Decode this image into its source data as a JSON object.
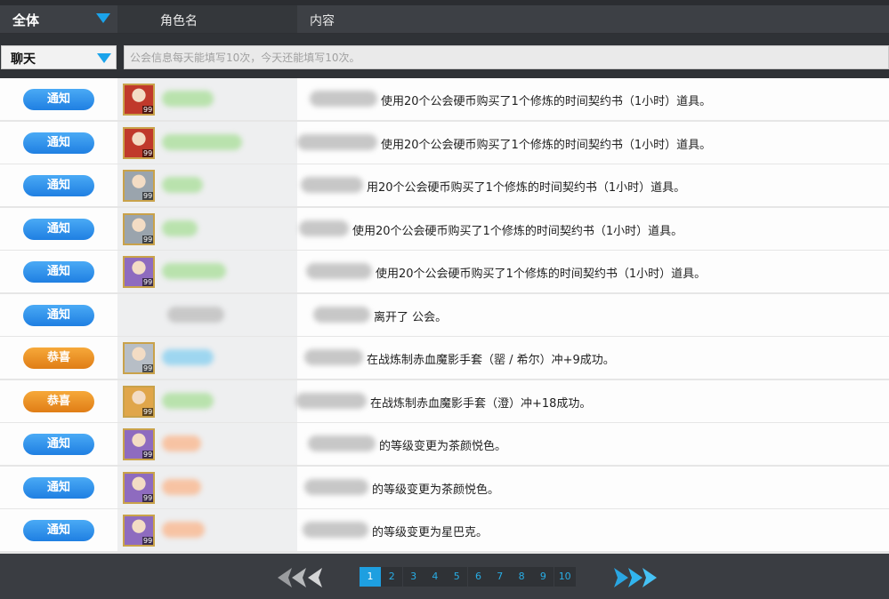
{
  "header": {
    "filter_label": "全体",
    "col_name": "角色名",
    "col_content": "内容"
  },
  "chat": {
    "channel": "聊天",
    "placeholder": "公会信息每天能填写10次，今天还能填写10次。"
  },
  "rows": [
    {
      "type": "通知",
      "kind": "notice",
      "level": "99",
      "avatar_color": "#c0392b",
      "name_color": "#b9e2ad",
      "message": "使用20个公会硬币购买了1个修炼的时间契约书（1小时）道具。"
    },
    {
      "type": "通知",
      "kind": "notice",
      "level": "99",
      "avatar_color": "#c0392b",
      "name_color": "#b9e2ad",
      "message": "使用20个公会硬币购买了1个修炼的时间契约书（1小时）道具。"
    },
    {
      "type": "通知",
      "kind": "notice",
      "level": "99",
      "avatar_color": "#9aa4ad",
      "name_color": "#b9e2ad",
      "message": "用20个公会硬币购买了1个修炼的时间契约书（1小时）道具。"
    },
    {
      "type": "通知",
      "kind": "notice",
      "level": "99",
      "avatar_color": "#9aa4ad",
      "name_color": "#b9e2ad",
      "message": "使用20个公会硬币购买了1个修炼的时间契约书（1小时）道具。"
    },
    {
      "type": "通知",
      "kind": "notice",
      "level": "99",
      "avatar_color": "#8e6bbf",
      "name_color": "#b9e2ad",
      "message": "使用20个公会硬币购买了1个修炼的时间契约书（1小时）道具。"
    },
    {
      "type": "通知",
      "kind": "notice",
      "level": "",
      "avatar_color": "",
      "name_color": "#c8c8c8",
      "message": "离开了 公会。"
    },
    {
      "type": "恭喜",
      "kind": "congrats",
      "level": "99",
      "avatar_color": "#b7bec6",
      "name_color": "#9ed6f0",
      "message": "在战炼制赤血魔影手套（罂 / 希尔）冲+9成功。"
    },
    {
      "type": "恭喜",
      "kind": "congrats",
      "level": "99",
      "avatar_color": "#e0a64a",
      "name_color": "#b9e2ad",
      "message": "在战炼制赤血魔影手套（澄）冲+18成功。"
    },
    {
      "type": "通知",
      "kind": "notice",
      "level": "99",
      "avatar_color": "#8e6bbf",
      "name_color": "#f7c3a3",
      "message": "的等级变更为茶颜悦色。"
    },
    {
      "type": "通知",
      "kind": "notice",
      "level": "99",
      "avatar_color": "#8e6bbf",
      "name_color": "#f7c3a3",
      "message": "的等级变更为茶颜悦色。"
    },
    {
      "type": "通知",
      "kind": "notice",
      "level": "99",
      "avatar_color": "#8e6bbf",
      "name_color": "#f7c3a3",
      "message": "的等级变更为星巴克。"
    }
  ],
  "pagination": {
    "current": "1",
    "pages": [
      "1",
      "2",
      "3",
      "4",
      "5",
      "6",
      "7",
      "8",
      "9",
      "10"
    ]
  },
  "colors": {
    "accent": "#1ba3ea",
    "notice_badge": "#2f8ef0",
    "congrats_badge": "#ef9126",
    "header_bg": "#3d4045"
  }
}
